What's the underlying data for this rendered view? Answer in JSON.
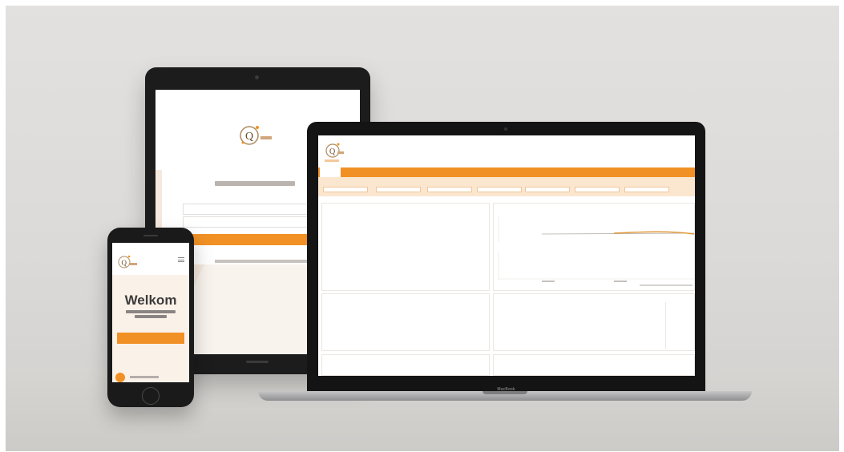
{
  "colors": {
    "accent": "#f19125",
    "accent_dark": "#e07d12",
    "peach": "#fbe6cf",
    "wall": "#dcdad8",
    "device": "#1a1a1b"
  },
  "tablet": {
    "status_left": "",
    "status_center": "",
    "status_right": "",
    "headline": "",
    "field_1_placeholder": "",
    "field_2_placeholder": "",
    "submit_label": "",
    "footer_text": ""
  },
  "laptop": {
    "brand": "MacBook",
    "nav": [
      "",
      "",
      "",
      ""
    ],
    "filters": [
      {
        "label": "",
        "value": ""
      },
      {
        "label": "",
        "value": ""
      },
      {
        "label": "",
        "value": ""
      },
      {
        "label": "",
        "value": ""
      },
      {
        "label": "",
        "value": ""
      },
      {
        "label": "",
        "value": ""
      },
      {
        "label": "",
        "value": ""
      }
    ],
    "panel_top_left": {
      "title": "",
      "group_1_title": "",
      "rows_1": [
        {
          "label": "",
          "value": ""
        },
        {
          "label": "",
          "value": ""
        }
      ],
      "group_2_title": "",
      "rows_2": [
        {
          "label": "",
          "value": ""
        },
        {
          "label": "",
          "value": ""
        }
      ],
      "extra_1": "",
      "extra_2": ""
    },
    "panel_top_right": {
      "title": ""
    },
    "panel_mid_left": {
      "title": "",
      "rows": [
        {
          "group": "",
          "label": "",
          "value": ""
        },
        {
          "group": "",
          "label": "",
          "value": ""
        }
      ]
    },
    "panel_mid_right": {
      "title": "",
      "rows": [
        {
          "group": "",
          "label": "",
          "value": ""
        },
        {
          "group": "",
          "label": "",
          "value": ""
        }
      ],
      "right_col": [
        {
          "group": "",
          "label": ""
        },
        {
          "group": "",
          "label": ""
        }
      ]
    },
    "panel_bottom_left": {
      "title": ""
    },
    "panel_bottom_right": {
      "title": ""
    }
  },
  "phone": {
    "status_left": "",
    "status_right": "",
    "welcome": "Welkom",
    "cta_label": "",
    "bottom_text": ""
  }
}
